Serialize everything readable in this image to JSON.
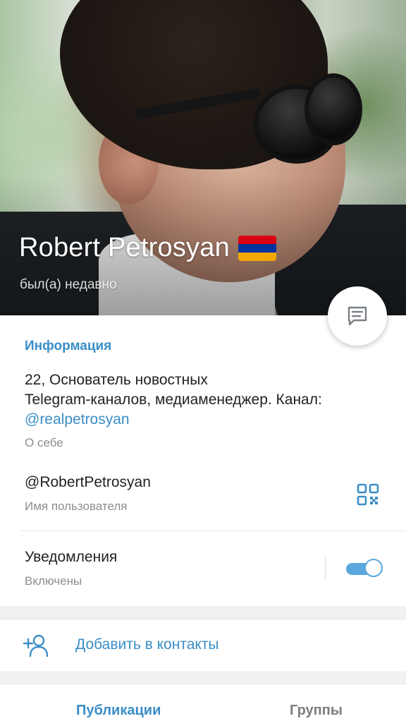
{
  "profile": {
    "name": "Robert Petrosyan",
    "status": "был(а) недавно",
    "flag_colors": [
      "#d90012",
      "#0033a0",
      "#f2a800"
    ]
  },
  "info": {
    "section_title": "Информация",
    "bio_line1": "22, Основатель новостных",
    "bio_line2": "Telegram-каналов, медиаменеджер. Канал:",
    "bio_link": "@realpetrosyan",
    "bio_caption": "О себе",
    "username": "@RobertPetrosyan",
    "username_caption": "Имя пользователя",
    "notifications_label": "Уведомления",
    "notifications_status": "Включены",
    "notifications_enabled": true
  },
  "actions": {
    "add_contact": "Добавить в контакты"
  },
  "tabs": [
    {
      "label": "Публикации",
      "active": true
    },
    {
      "label": "Группы",
      "active": false
    }
  ],
  "icons": {
    "fab": "message-icon",
    "qr": "qr-code-icon",
    "add_contact": "add-user-icon"
  },
  "colors": {
    "accent": "#3a8ec6",
    "toggle": "#5aa7de"
  }
}
